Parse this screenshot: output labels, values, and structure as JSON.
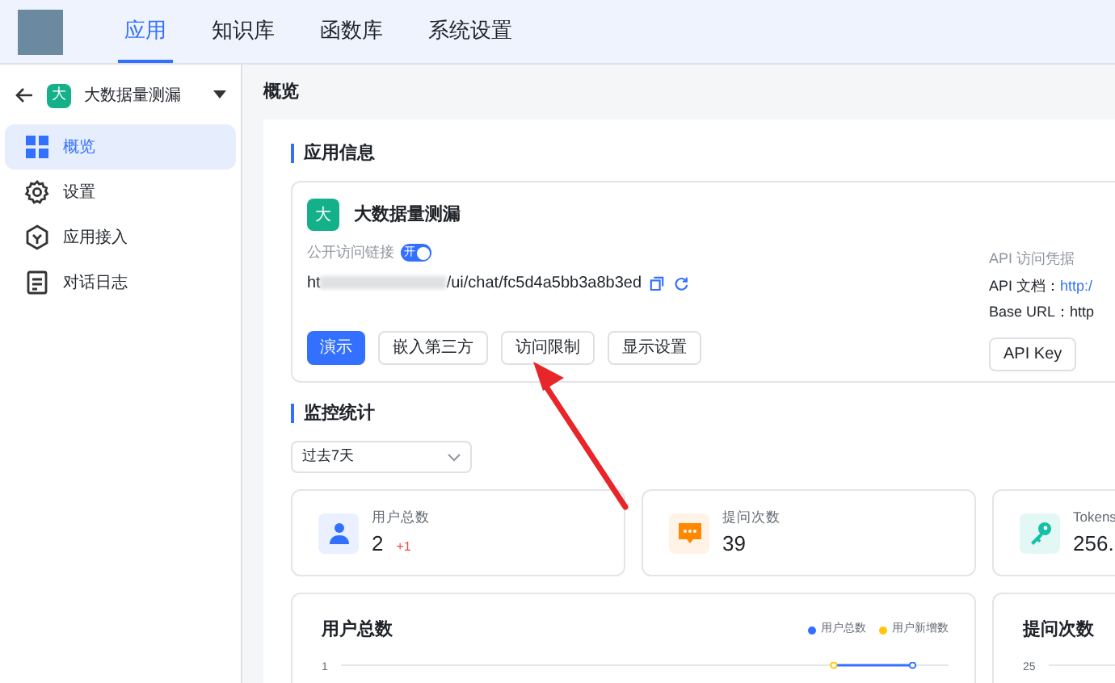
{
  "top_nav": {
    "tabs": [
      {
        "label": "应用",
        "selected": true
      },
      {
        "label": "知识库",
        "selected": false
      },
      {
        "label": "函数库",
        "selected": false
      },
      {
        "label": "系统设置",
        "selected": false
      }
    ]
  },
  "sidebar": {
    "app_avatar": "大",
    "app_name": "大数据量测漏",
    "items": [
      {
        "label": "概览",
        "kind": "grid",
        "selected": true
      },
      {
        "label": "设置",
        "kind": "gear",
        "selected": false
      },
      {
        "label": "应用接入",
        "kind": "hex",
        "selected": false
      },
      {
        "label": "对话日志",
        "kind": "doc",
        "selected": false
      }
    ]
  },
  "page_title": "概览",
  "app_info": {
    "section_title": "应用信息",
    "avatar": "大",
    "name": "大数据量测漏",
    "public_link_label": "公开访问链接",
    "public_link_switch": {
      "label": "开",
      "on": true
    },
    "url_start": "ht",
    "url_end": "/ui/chat/fc5d4a5bb3a8b3ed",
    "buttons": [
      {
        "label": "演示",
        "primary": true
      },
      {
        "label": "嵌入第三方",
        "primary": false
      },
      {
        "label": "访问限制",
        "primary": false
      },
      {
        "label": "显示设置",
        "primary": false
      }
    ],
    "api_title": "API 访问凭据",
    "api_doc_label": "API 文档：",
    "api_doc_value": "http:/",
    "base_url_label": "Base URL：",
    "base_url_value": "http",
    "api_key_button": "API Key"
  },
  "monitor": {
    "section_title": "监控统计",
    "range": "过去7天",
    "stats": [
      {
        "label": "用户总数",
        "value": "2",
        "delta": "+1",
        "kind": "user"
      },
      {
        "label": "提问次数",
        "value": "39",
        "kind": "chat"
      },
      {
        "label": "Tokens",
        "value": "256.",
        "kind": "key"
      }
    ],
    "charts": [
      {
        "title": "用户总数",
        "legend": [
          {
            "name": "用户总数",
            "color": "#3370ff"
          },
          {
            "name": "用户新增数",
            "color": "#ffc60a"
          }
        ],
        "tick": "1"
      },
      {
        "title": "提问次数",
        "tick": "25"
      }
    ]
  }
}
